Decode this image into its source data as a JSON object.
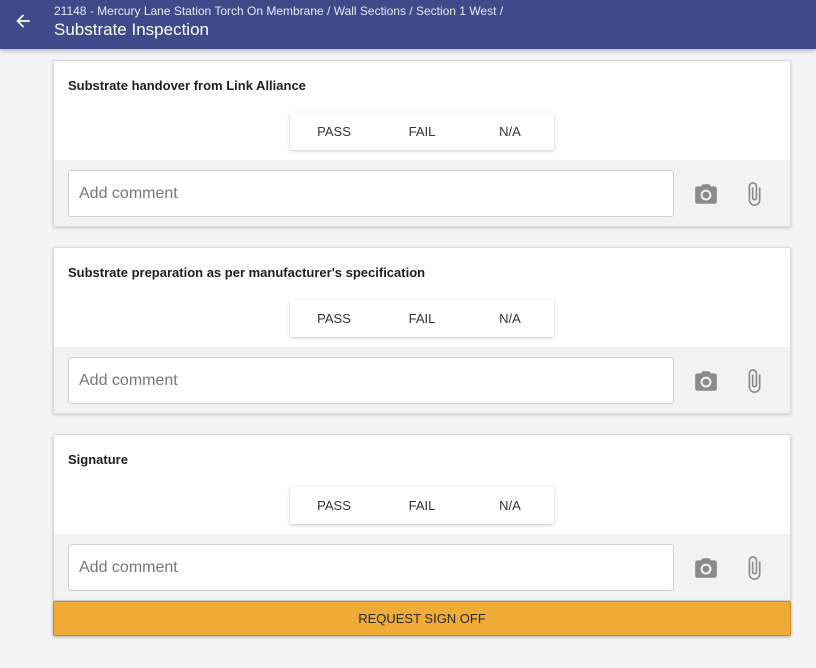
{
  "header": {
    "breadcrumb": "21148 - Mercury Lane Station Torch On Membrane / Wall Sections / Section 1 West /",
    "title": "Substrate Inspection",
    "background_color": "#3f4a8a"
  },
  "items": [
    {
      "title": "Substrate handover from Link Alliance",
      "options": [
        "PASS",
        "FAIL",
        "N/A"
      ],
      "comment_placeholder": "Add comment"
    },
    {
      "title": "Substrate preparation as per manufacturer's specification",
      "options": [
        "PASS",
        "FAIL",
        "N/A"
      ],
      "comment_placeholder": "Add comment"
    },
    {
      "title": "Signature",
      "options": [
        "PASS",
        "FAIL",
        "N/A"
      ],
      "comment_placeholder": "Add comment"
    }
  ],
  "footer": {
    "signoff_label": "REQUEST SIGN OFF",
    "signoff_color": "#f0ab37"
  },
  "icons": {
    "back": "arrow-left-icon",
    "camera": "camera-icon",
    "attach": "paperclip-icon"
  }
}
